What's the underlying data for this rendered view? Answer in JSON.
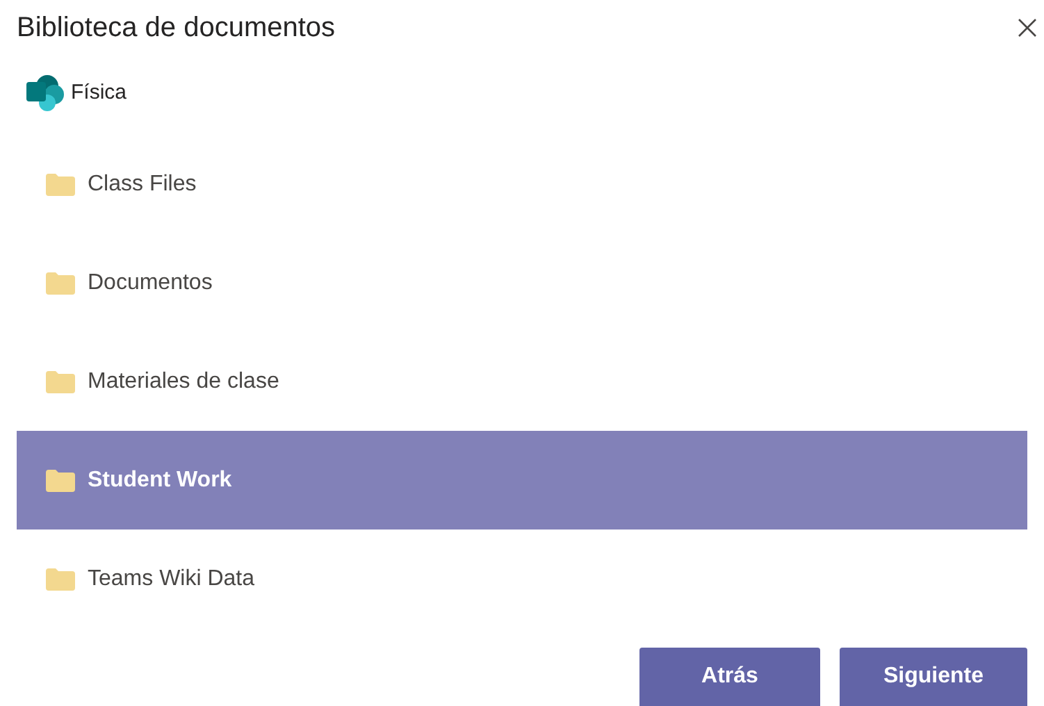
{
  "dialog": {
    "title": "Biblioteca de documentos"
  },
  "site": {
    "name": "Física"
  },
  "folders": [
    {
      "name": "Class Files",
      "selected": false
    },
    {
      "name": "Documentos",
      "selected": false
    },
    {
      "name": "Materiales de clase",
      "selected": false
    },
    {
      "name": "Student Work",
      "selected": true
    },
    {
      "name": "Teams Wiki Data",
      "selected": false
    }
  ],
  "buttons": [
    "Atrás",
    "Siguiente"
  ]
}
